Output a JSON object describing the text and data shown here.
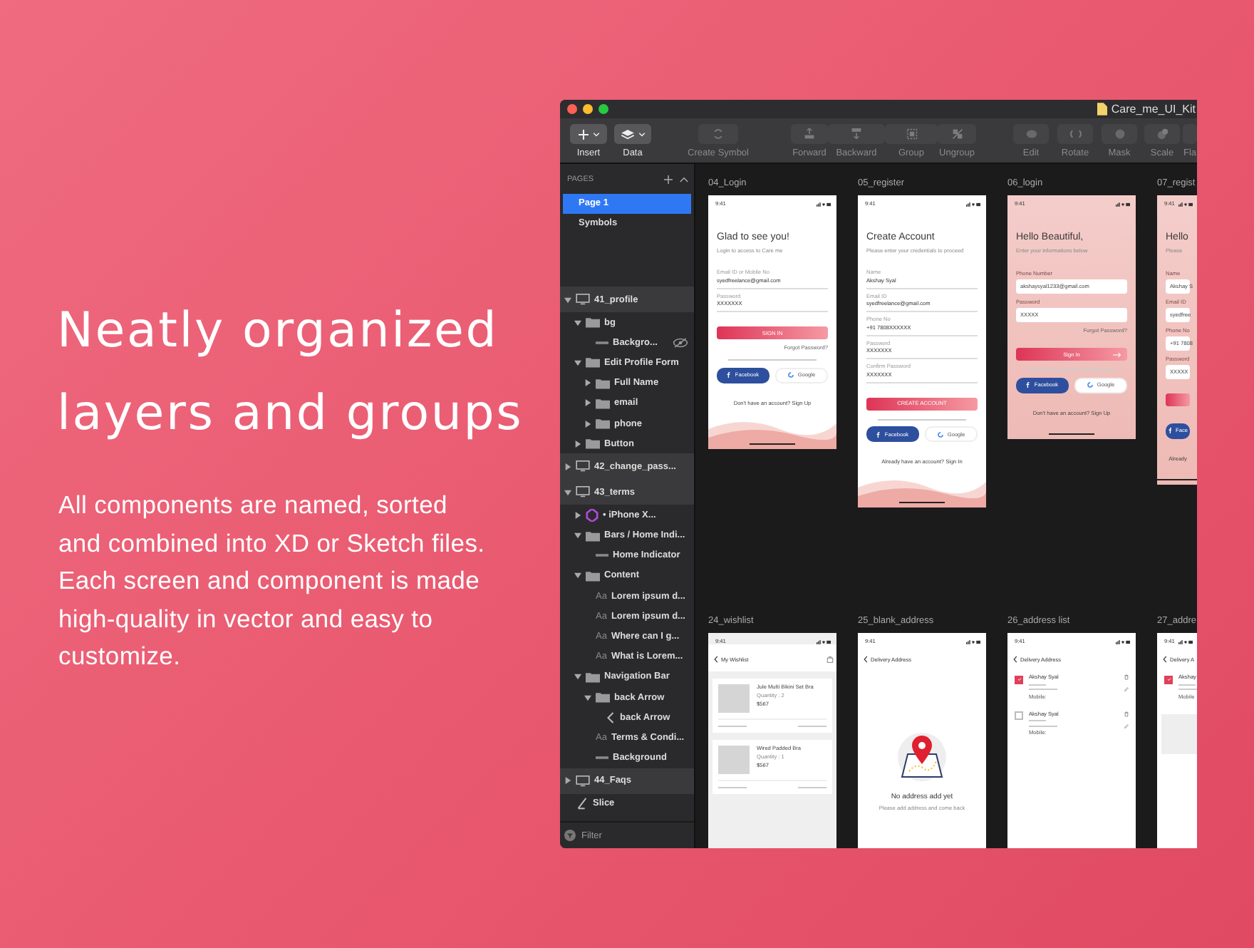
{
  "headline": {
    "lines": [
      "Neatly organized",
      "layers and groups"
    ]
  },
  "body": {
    "lines": [
      "All components are named, sorted",
      "and combined into XD or Sketch files.",
      "Each screen and component is made",
      "high-quality in vector and easy to",
      "customize."
    ]
  },
  "window": {
    "title": "Care_me_UI_Kit",
    "traffic_lights": [
      {
        "color": "#fe5f57"
      },
      {
        "color": "#febc2e"
      },
      {
        "color": "#28c840"
      }
    ]
  },
  "toolbar": [
    {
      "label": "Insert",
      "kind": "dropdown",
      "disabled": false
    },
    {
      "label": "Data",
      "kind": "dropdown",
      "disabled": false
    },
    {
      "label": "Create Symbol",
      "kind": "button",
      "disabled": true
    },
    {
      "label": "Forward",
      "kind": "button",
      "disabled": true
    },
    {
      "label": "Backward",
      "kind": "button",
      "disabled": true
    },
    {
      "label": "Group",
      "kind": "button",
      "disabled": true
    },
    {
      "label": "Ungroup",
      "kind": "button",
      "disabled": true
    },
    {
      "label": "Edit",
      "kind": "button",
      "disabled": true
    },
    {
      "label": "Rotate",
      "kind": "button",
      "disabled": true
    },
    {
      "label": "Mask",
      "kind": "button",
      "disabled": true
    },
    {
      "label": "Scale",
      "kind": "button",
      "disabled": true
    },
    {
      "label": "Fla",
      "kind": "button",
      "disabled": true
    }
  ],
  "pages": {
    "title": "PAGES",
    "items": [
      {
        "label": "Page 1",
        "selected": true
      },
      {
        "label": "Symbols",
        "selected": false
      }
    ]
  },
  "layers": [
    {
      "name": "41_profile",
      "kind": "artboard",
      "expanded": true,
      "children": [
        {
          "name": "bg",
          "kind": "group",
          "expanded": true,
          "children": [
            {
              "name": "Backgro...",
              "kind": "shape",
              "hidden": true
            }
          ]
        },
        {
          "name": "Edit Profile Form",
          "kind": "group",
          "expanded": true,
          "children": [
            {
              "name": "Full Name",
              "kind": "group",
              "expanded": false
            },
            {
              "name": "email",
              "kind": "group",
              "expanded": false
            },
            {
              "name": "phone",
              "kind": "group",
              "expanded": false
            }
          ]
        },
        {
          "name": "Button",
          "kind": "group",
          "expanded": false
        }
      ]
    },
    {
      "name": "42_change_pass...",
      "kind": "artboard",
      "expanded": false
    },
    {
      "name": "43_terms",
      "kind": "artboard",
      "expanded": true,
      "children": [
        {
          "name": "• iPhone X...",
          "kind": "symbol",
          "expanded": false
        },
        {
          "name": "Bars / Home Indi...",
          "kind": "group",
          "expanded": true,
          "children": [
            {
              "name": "Home Indicator",
              "kind": "shape"
            }
          ]
        },
        {
          "name": "Content",
          "kind": "group",
          "expanded": true,
          "children": [
            {
              "name": "Lorem ipsum d...",
              "kind": "text",
              "glyph": "Aa"
            },
            {
              "name": "Lorem ipsum d...",
              "kind": "text",
              "glyph": "Aa"
            },
            {
              "name": "Where can I g...",
              "kind": "text",
              "glyph": "Aa"
            },
            {
              "name": "What is Lorem...",
              "kind": "text",
              "glyph": "Aa"
            }
          ]
        },
        {
          "name": "Navigation Bar",
          "kind": "group",
          "expanded": true,
          "children": [
            {
              "name": "back Arrow",
              "kind": "group",
              "expanded": true,
              "children": [
                {
                  "name": "back Arrow",
                  "kind": "chevron"
                }
              ]
            },
            {
              "name": "Terms & Condi...",
              "kind": "text",
              "glyph": "Aa"
            },
            {
              "name": "Background",
              "kind": "shape"
            }
          ]
        }
      ]
    },
    {
      "name": "44_Faqs",
      "kind": "artboard",
      "expanded": false
    },
    {
      "name": "Slice",
      "kind": "slice"
    }
  ],
  "filter": {
    "placeholder": "Filter"
  },
  "canvas": {
    "rows": [
      [
        {
          "name": "04_Login",
          "kind": "form",
          "time": "9:41",
          "title": "Glad to see you!",
          "subtitle": "Login to access to Care me",
          "fields": [
            {
              "label": "Email ID or Mobile No",
              "value": "syedfreelance@gmail.com"
            },
            {
              "label": "Password",
              "value": "XXXXXXX"
            }
          ],
          "button": "SIGN IN",
          "forgot": "Forgot Password?",
          "social": [
            "Facebook",
            "Google"
          ],
          "footer": "Don't have an account? Sign Up"
        },
        {
          "name": "05_register",
          "kind": "form",
          "time": "9:41",
          "title": "Create Account",
          "subtitle": "Please enter your credentials to proceed",
          "fields": [
            {
              "label": "Name",
              "value": "Akshay Syal"
            },
            {
              "label": "Email ID",
              "value": "syedfreelance@gmail.com"
            },
            {
              "label": "Phone No",
              "value": "+91 7808XXXXXX"
            },
            {
              "label": "Password",
              "value": "XXXXXXX"
            },
            {
              "label": "Confirm Password",
              "value": "XXXXXXX"
            }
          ],
          "button": "CREATE ACCOUNT",
          "social": [
            "Facebook",
            "Google"
          ],
          "footer": "Already have an account? Sign In"
        },
        {
          "name": "06_login",
          "kind": "pinkform",
          "time": "9:41",
          "title": "Hello Beautiful,",
          "subtitle": "Enter your informations below",
          "fields": [
            {
              "label": "Phone Number",
              "value": "akshaysyal1233@gmail.com"
            },
            {
              "label": "Password",
              "value": "XXXXX"
            }
          ],
          "forgot": "Forgot Password?",
          "button": "Sign In",
          "social": [
            "Facebook",
            "Google"
          ],
          "footer": "Don't have an account? Sign Up"
        },
        {
          "name": "07_regist",
          "kind": "pinkform",
          "time": "9:41",
          "title": "Hello",
          "subtitle": "Please",
          "fields": [
            {
              "label": "Name",
              "value": "Akshay S"
            },
            {
              "label": "Email ID",
              "value": "syedfree"
            },
            {
              "label": "Phone No",
              "value": "+91 7808"
            },
            {
              "label": "Password",
              "value": "XXXXX"
            }
          ],
          "social": [
            "Face"
          ],
          "footer": "Already"
        }
      ],
      [
        {
          "name": "24_wishlist",
          "kind": "wishlist",
          "time": "9:41",
          "title": "My Wishlist",
          "cards": [
            {
              "title": "Jule Multi Bikini Set Bra",
              "quantity": "Quantity : 2",
              "price": "$567"
            },
            {
              "title": "Wired Padded Bra",
              "quantity": "Quantity : 1",
              "price": "$567"
            }
          ]
        },
        {
          "name": "25_blank_address",
          "kind": "empty",
          "time": "9:41",
          "title": "Delivery Address",
          "message": "No address add yet",
          "note": "Please add address and come back"
        },
        {
          "name": "26_address list",
          "kind": "addresses",
          "time": "9:41",
          "title": "Delivery Address",
          "addresses": [
            {
              "name": "Akshay Syal",
              "mobile": "Mobile:",
              "selected": true
            },
            {
              "name": "Akshay Syal",
              "mobile": "Mobile:",
              "selected": false
            }
          ]
        },
        {
          "name": "27_addre",
          "kind": "addresses",
          "time": "9:41",
          "title": "Delivery A",
          "addresses": [
            {
              "name": "Akshay",
              "mobile": "Mobile",
              "selected": true
            }
          ]
        }
      ]
    ]
  }
}
